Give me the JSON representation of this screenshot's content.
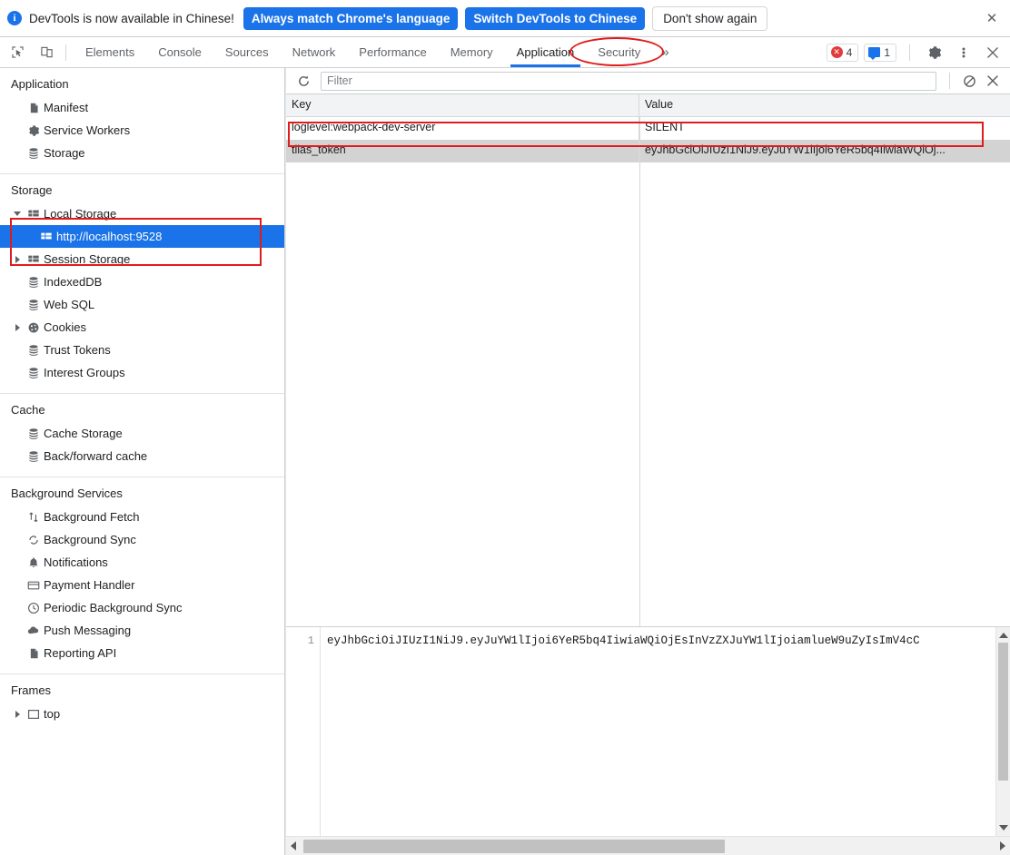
{
  "banner": {
    "icon": "info-icon",
    "message": "DevTools is now available in Chinese!",
    "primary_button": "Always match Chrome's language",
    "secondary_button": "Switch DevTools to Chinese",
    "dismiss_button": "Don't show again",
    "close_icon": "✕"
  },
  "toolbar": {
    "inspect_icon": "inspect-element-icon",
    "device_icon": "device-toolbar-icon",
    "tabs": [
      {
        "label": "Elements",
        "active": false
      },
      {
        "label": "Console",
        "active": false
      },
      {
        "label": "Sources",
        "active": false
      },
      {
        "label": "Network",
        "active": false
      },
      {
        "label": "Performance",
        "active": false
      },
      {
        "label": "Memory",
        "active": false
      },
      {
        "label": "Application",
        "active": true
      },
      {
        "label": "Security",
        "active": false
      }
    ],
    "more_tabs": "»",
    "error_count": "4",
    "message_count": "1",
    "settings_icon": "gear-icon",
    "kebab_icon": "more-options-icon",
    "close_icon": "✕"
  },
  "sidebar": {
    "sections": [
      {
        "title": "Application",
        "items": [
          {
            "label": "Manifest",
            "icon": "manifest-file-icon",
            "twisty": "none",
            "child": false,
            "selected": false
          },
          {
            "label": "Service Workers",
            "icon": "gear-icon",
            "twisty": "none",
            "child": false,
            "selected": false
          },
          {
            "label": "Storage",
            "icon": "database-icon",
            "twisty": "none",
            "child": false,
            "selected": false
          }
        ]
      },
      {
        "title": "Storage",
        "items": [
          {
            "label": "Local Storage",
            "icon": "table-grid-icon",
            "twisty": "expanded",
            "child": false,
            "selected": false
          },
          {
            "label": "http://localhost:9528",
            "icon": "table-grid-icon",
            "twisty": "none",
            "child": true,
            "selected": true
          },
          {
            "label": "Session Storage",
            "icon": "table-grid-icon",
            "twisty": "collapsed",
            "child": false,
            "selected": false
          },
          {
            "label": "IndexedDB",
            "icon": "database-icon",
            "twisty": "none",
            "child": false,
            "selected": false
          },
          {
            "label": "Web SQL",
            "icon": "database-icon",
            "twisty": "none",
            "child": false,
            "selected": false
          },
          {
            "label": "Cookies",
            "icon": "cookie-icon",
            "twisty": "collapsed",
            "child": false,
            "selected": false
          },
          {
            "label": "Trust Tokens",
            "icon": "database-icon",
            "twisty": "none",
            "child": false,
            "selected": false
          },
          {
            "label": "Interest Groups",
            "icon": "database-icon",
            "twisty": "none",
            "child": false,
            "selected": false
          }
        ]
      },
      {
        "title": "Cache",
        "items": [
          {
            "label": "Cache Storage",
            "icon": "database-icon",
            "twisty": "none",
            "child": false,
            "selected": false
          },
          {
            "label": "Back/forward cache",
            "icon": "database-icon",
            "twisty": "none",
            "child": false,
            "selected": false
          }
        ]
      },
      {
        "title": "Background Services",
        "items": [
          {
            "label": "Background Fetch",
            "icon": "arrows-updown-icon",
            "twisty": "none",
            "child": false,
            "selected": false
          },
          {
            "label": "Background Sync",
            "icon": "sync-icon",
            "twisty": "none",
            "child": false,
            "selected": false
          },
          {
            "label": "Notifications",
            "icon": "bell-icon",
            "twisty": "none",
            "child": false,
            "selected": false
          },
          {
            "label": "Payment Handler",
            "icon": "credit-card-icon",
            "twisty": "none",
            "child": false,
            "selected": false
          },
          {
            "label": "Periodic Background Sync",
            "icon": "clock-icon",
            "twisty": "none",
            "child": false,
            "selected": false
          },
          {
            "label": "Push Messaging",
            "icon": "cloud-icon",
            "twisty": "none",
            "child": false,
            "selected": false
          },
          {
            "label": "Reporting API",
            "icon": "manifest-file-icon",
            "twisty": "none",
            "child": false,
            "selected": false
          }
        ]
      },
      {
        "title": "Frames",
        "items": [
          {
            "label": "top",
            "icon": "frame-icon",
            "twisty": "collapsed",
            "child": false,
            "selected": false
          }
        ]
      }
    ]
  },
  "main": {
    "refresh_icon": "refresh-icon",
    "filter_placeholder": "Filter",
    "filter_value": "",
    "clear_all_icon": "no-entry-clear-icon",
    "delete_selected_icon": "delete-x-icon",
    "columns": [
      "Key",
      "Value"
    ],
    "rows": [
      {
        "key": "tlias_token",
        "value": "eyJhbGciOiJIUzI1NiJ9.eyJuYW1lIjoi6YeR5bq4IiwiaWQiOj...",
        "selected": true
      },
      {
        "key": "loglevel:webpack-dev-server",
        "value": "SILENT",
        "selected": false
      }
    ]
  },
  "preview": {
    "line_number": "1",
    "content": "eyJhbGciOiJIUzI1NiJ9.eyJuYW1lIjoi6YeR5bq4IiwiaWQiOjEsInVzZXJuYW1lIjoiamlueW9uZyIsImV4cC"
  },
  "annotations": {
    "accent_color": "#e01b1b",
    "items": [
      {
        "shape": "ellipse",
        "target": "application-tab"
      },
      {
        "shape": "rect",
        "target": "local-storage-group"
      },
      {
        "shape": "rect",
        "target": "tlias-token-row"
      }
    ]
  },
  "colors": {
    "brand_blue": "#1a73e8",
    "selection_blue": "#1a73e8",
    "row_selected_gray": "#d3d3d3",
    "annotation_red": "#e01b1b"
  }
}
